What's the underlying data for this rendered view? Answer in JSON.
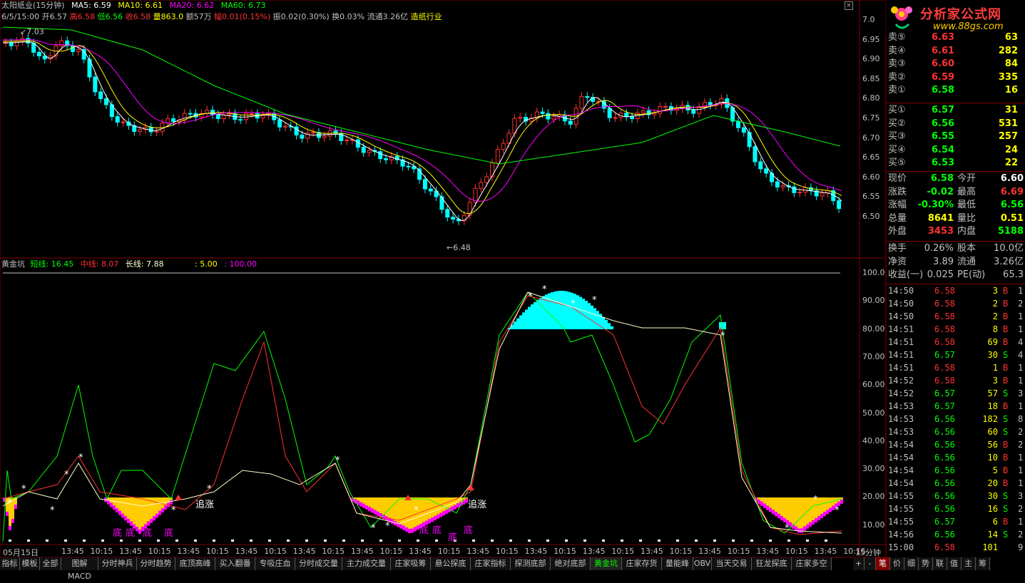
{
  "info": {
    "stock": "太阳纸业(15分钟)",
    "ma5": "MA5: 6.59",
    "ma10": "MA10: 6.61",
    "ma20": "MA20: 6.62",
    "ma60": "MA60: 6.73",
    "date": "6/5/15:00",
    "open": "开6.57",
    "high": "高6.58",
    "low": "低6.56",
    "close": "收6.58",
    "vol": "量863.0",
    "amt": "额57万",
    "chg": "幅0.01(0.15%)",
    "amp": "振0.02(0.30%)",
    "turn": "换0.03%",
    "float": "流通3.26亿",
    "industry": "造纸行业"
  },
  "price_axis": [
    "7.0",
    "6.95",
    "6.90",
    "6.85",
    "6.80",
    "6.75",
    "6.70",
    "6.65",
    "6.60",
    "6.55",
    "6.50"
  ],
  "price_annot": {
    "high": "7.03",
    "low": "6.48"
  },
  "indicator": {
    "name": "黄金坑",
    "short": "短线: 16.45",
    "mid": "中线: 8.07",
    "long": "长线: 7.88",
    "p1": ": 5.00",
    "p2": ": 100.00",
    "axis": [
      "100.0",
      "90.00",
      "80.00",
      "70.00",
      "60.00",
      "50.00",
      "40.00",
      "30.00",
      "20.00",
      "10.00"
    ],
    "labels": [
      "底",
      "底",
      "底",
      "底",
      "底",
      "底",
      "底",
      "底"
    ],
    "chase": [
      "追涨",
      "追涨"
    ]
  },
  "x_axis": {
    "first": "05月15日",
    "ticks": [
      "13:45",
      "10:15",
      "13:45",
      "10:15",
      "13:45",
      "10:15",
      "13:45",
      "10:15",
      "13:45",
      "10:15",
      "13:45",
      "10:15",
      "13:45",
      "10:15",
      "13:45",
      "10:15",
      "13:45",
      "10:15",
      "13:45",
      "10:15",
      "13:45",
      "10:15",
      "13:45",
      "10:15",
      "13:45",
      "10:15",
      "13:45",
      "10:15"
    ],
    "period": "15分钟"
  },
  "logo": {
    "title": "分析家公式网",
    "url": "www.88gs.com"
  },
  "order_book": {
    "sells": [
      {
        "label": "卖⑤",
        "price": "6.63",
        "vol": "63"
      },
      {
        "label": "卖④",
        "price": "6.61",
        "vol": "282"
      },
      {
        "label": "卖③",
        "price": "6.60",
        "vol": "84"
      },
      {
        "label": "卖②",
        "price": "6.59",
        "vol": "335"
      },
      {
        "label": "卖①",
        "price": "6.58",
        "vol": "16"
      }
    ],
    "buys": [
      {
        "label": "买①",
        "price": "6.57",
        "vol": "31"
      },
      {
        "label": "买②",
        "price": "6.56",
        "vol": "531"
      },
      {
        "label": "买③",
        "price": "6.55",
        "vol": "257"
      },
      {
        "label": "买④",
        "price": "6.54",
        "vol": "24"
      },
      {
        "label": "买⑤",
        "price": "6.53",
        "vol": "22"
      }
    ]
  },
  "quote": [
    {
      "l1": "现价",
      "v1": "6.58",
      "l2": "今开",
      "v2": "6.60"
    },
    {
      "l1": "涨跌",
      "v1": "-0.02",
      "l2": "最高",
      "v2": "6.69"
    },
    {
      "l1": "涨幅",
      "v1": "-0.30%",
      "l2": "最低",
      "v2": "6.56"
    },
    {
      "l1": "总量",
      "v1": "8641",
      "l2": "量比",
      "v2": "0.51"
    },
    {
      "l1": "外盘",
      "v1": "3453",
      "l2": "内盘",
      "v2": "5188"
    }
  ],
  "fundamentals": [
    {
      "l1": "换手",
      "v1": "0.26%",
      "l2": "股本",
      "v2": "10.0亿"
    },
    {
      "l1": "净资",
      "v1": "3.89",
      "l2": "流通",
      "v2": "3.26亿"
    },
    {
      "l1": "收益(一)",
      "v1": "0.025",
      "l2": "PE(动)",
      "v2": "65.3"
    }
  ],
  "ticks": [
    {
      "t": "14:50",
      "p": "6.58",
      "v": "3",
      "s": "B",
      "n": "1"
    },
    {
      "t": "14:50",
      "p": "6.58",
      "v": "2",
      "s": "B",
      "n": "2"
    },
    {
      "t": "14:50",
      "p": "6.58",
      "v": "2",
      "s": "B",
      "n": "1"
    },
    {
      "t": "14:51",
      "p": "6.58",
      "v": "8",
      "s": "B",
      "n": "1"
    },
    {
      "t": "14:51",
      "p": "6.58",
      "v": "69",
      "s": "B",
      "n": "4"
    },
    {
      "t": "14:51",
      "p": "6.57",
      "v": "30",
      "s": "S",
      "n": "4"
    },
    {
      "t": "14:51",
      "p": "6.58",
      "v": "1",
      "s": "B",
      "n": "1"
    },
    {
      "t": "14:52",
      "p": "6.58",
      "v": "3",
      "s": "B",
      "n": "1"
    },
    {
      "t": "14:52",
      "p": "6.57",
      "v": "57",
      "s": "S",
      "n": "3"
    },
    {
      "t": "14:53",
      "p": "6.57",
      "v": "18",
      "s": "B",
      "n": "1"
    },
    {
      "t": "14:53",
      "p": "6.56",
      "v": "182",
      "s": "S",
      "n": "8"
    },
    {
      "t": "14:53",
      "p": "6.56",
      "v": "60",
      "s": "S",
      "n": "2"
    },
    {
      "t": "14:54",
      "p": "6.56",
      "v": "56",
      "s": "B",
      "n": "2"
    },
    {
      "t": "14:54",
      "p": "6.56",
      "v": "10",
      "s": "B",
      "n": "1"
    },
    {
      "t": "14:54",
      "p": "6.56",
      "v": "5",
      "s": "B",
      "n": "1"
    },
    {
      "t": "14:54",
      "p": "6.56",
      "v": "20",
      "s": "B",
      "n": "1"
    },
    {
      "t": "14:55",
      "p": "6.56",
      "v": "30",
      "s": "S",
      "n": "3"
    },
    {
      "t": "14:55",
      "p": "6.56",
      "v": "16",
      "s": "S",
      "n": "2"
    },
    {
      "t": "14:55",
      "p": "6.57",
      "v": "6",
      "s": "B",
      "n": "1"
    },
    {
      "t": "14:56",
      "p": "6.56",
      "v": "14",
      "s": "S",
      "n": "2"
    },
    {
      "t": "15:00",
      "p": "6.58",
      "v": "101",
      "s": "",
      "n": "9"
    }
  ],
  "bottom_tabs": [
    "指标",
    "模板",
    "全部",
    "图解MACD",
    "分时神兵",
    "分时趋势",
    "底顶高峰",
    "买入翻番",
    "专吸庄血",
    "分时成交量",
    "主力成交量",
    "庄家吸筹",
    "悬公探底",
    "庄家指标",
    "探测底部",
    "绝对底部",
    "黄金坑",
    "庄家存货",
    "量能峰",
    "OBV",
    "当天交易",
    "狂龙探底",
    "庄家多空"
  ],
  "active_tab": "黄金坑",
  "right_tabs": [
    "+",
    "-",
    "笔",
    "价",
    "细",
    "势",
    "联",
    "值",
    "主",
    "筹"
  ],
  "colors": {
    "up": "#ff3232",
    "down": "#00ffff",
    "ma5": "#ffffff",
    "ma10": "#ffff00",
    "ma20": "#ff00ff",
    "ma60": "#00ff00",
    "cyan_fill": "#00ffff",
    "yellow_fill": "#ffcc00",
    "magenta_fill": "#ff00ff"
  }
}
